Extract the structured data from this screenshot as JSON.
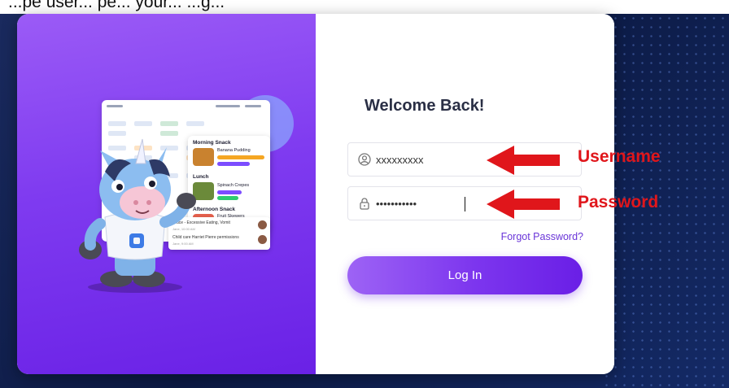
{
  "instruction": {
    "text": "...pe user... pe... your... ...g..."
  },
  "login": {
    "welcome_title": "Welcome Back!",
    "username_value": "xxxxxxxxx",
    "password_value": "•••••••••••",
    "forgot_password_label": "Forgot Password?",
    "login_button_label": "Log In"
  },
  "illustration": {
    "meal_sections": [
      {
        "title": "Morning Snack",
        "item": "Banana Pudding"
      },
      {
        "title": "Lunch",
        "item": "Spinach Crepes"
      },
      {
        "title": "Afternoon Snack",
        "item": "Fruit Skewers"
      }
    ],
    "notifications": [
      {
        "text": "Bruce - Excessive Eating, Vomit",
        "sub": "Jane, 10:00 AM"
      },
      {
        "text": "Child care Harriet Pierre permissions",
        "sub": "Jane, 9:00 AM"
      }
    ]
  },
  "annotations": {
    "username_label": "Username",
    "password_label": "Password"
  },
  "colors": {
    "brand_purple": "#7c35ee",
    "annotation_red": "#e0161b",
    "link_purple": "#6a35d8"
  },
  "icons": {
    "username_field": "user-circle-icon",
    "password_field": "lock-icon"
  }
}
